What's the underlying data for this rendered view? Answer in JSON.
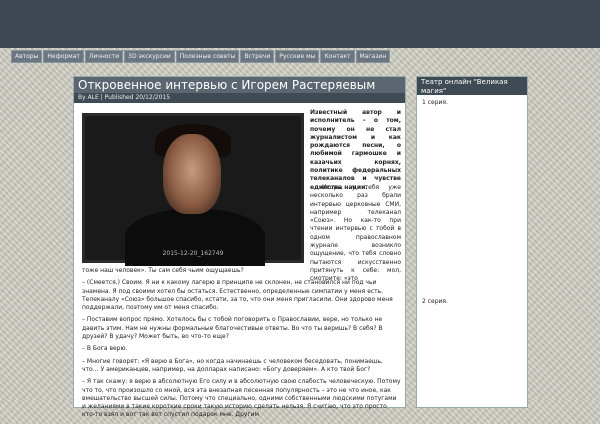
{
  "nav": [
    "Авторы",
    "Неформат",
    "Личности",
    "3D экскурсии",
    "Полезные советы",
    "Встречи",
    "Русские мы",
    "Контакт",
    "Магазин"
  ],
  "post": {
    "title": "Откровенное интервью с Игорем Растеряевым",
    "meta": "By ALE | Published 20/12/2015",
    "video_caption": "2015-12-20_162749",
    "intro": "Известный автор и исполнитель – о том, почему он не стал журналистом и как рождаются песни, о любимой гармошке и казачьих корнях, политике федеральных телеканалов и чувстве единства нации.",
    "side_text": "– Игорь, у тебя уже несколько раз брали интервью церковные СМИ, например телеканал «Союз». Но как-то при чтении интервью с тобой в одном православном журнале возникло ощущение, что тебя словно пытаются искусственно притянуть к себе: мол, смотрите: «это",
    "paragraphs": [
      "тоже наш человек». Ты сам себя чьим ощущаешь?",
      "– (Смеется.) Своим. Я ни к какому лагерю в принципе не склонен, не становился ни под чьи знамена. Я под своими хотел бы остаться. Естественно, определенные симпатии у меня есть. Телеканалу «Союз» большое спасибо, кстати, за то, что они меня пригласили. Они здорово меня поддержали, поэтому им от меня спасибо.",
      "– Поставим вопрос прямо. Хотелось бы с тобой поговорить о Православии, вере, но только не давить этим. Нам не нужны формальные благочестивые ответы. Во что ты веришь? В себя? В друзей? В удачу? Может быть, во что-то еще?",
      "– В Бога верю.",
      "– Многие говорят: «Я верю в Бога», но когда начинаешь с человеком беседовать, понимаешь, что… У американцев, например, на долларах написано: «Богу доверяем». А кто твой Бог?",
      "– Я так скажу: я верю в абсолютную Его силу и в абсолютную свою слабость человеческую. Потому что то, что произошло со мной, вся эта внезапная песенная популярность – это не что иное, как вмешательство высшей силы. Потому что специально, одними собственными людскими потугами и желаниями в такие короткие сроки такую историю сделать нельзя. Я считаю, что это просто кто-то взял и вот так вот спустил подарок мне. Другим"
    ]
  },
  "sidebar": {
    "title": "Театр онлайн \"Великая магия\"",
    "items": [
      "1 серия.",
      "2 серия."
    ]
  }
}
